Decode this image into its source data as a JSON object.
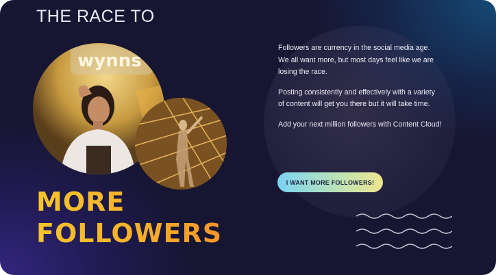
{
  "hero": {
    "kicker": "THE RACE TO",
    "headline_line1": "MORE",
    "headline_line2": "FOLLOWERS"
  },
  "copy": {
    "paragraph1": "Followers are currency in the social media age. We all want more, but most days feel like we are losing the race.",
    "paragraph2": "Posting consistently and effectively with a variety of content will get you there but it will take time.",
    "paragraph3": "Add your next million followers with Content Cloud!"
  },
  "cta": {
    "label": "I WANT MORE FOLLOWERS!"
  },
  "photos": {
    "sign_text": "wynns"
  },
  "colors": {
    "background": "#171632",
    "headline_start": "#f7c52a",
    "headline_end": "#f4952a",
    "cta_start": "#7cd3f3",
    "cta_end": "#efe58e",
    "text": "#eceaf6"
  }
}
